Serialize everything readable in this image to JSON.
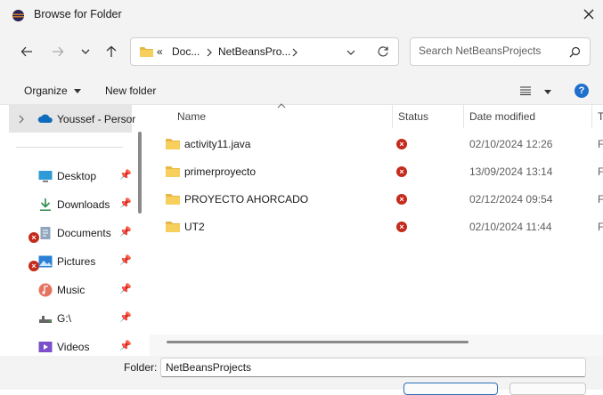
{
  "window": {
    "title": "Browse for Folder"
  },
  "address": {
    "overflow": "«",
    "segments": [
      "Doc...",
      "NetBeansPro..."
    ]
  },
  "search": {
    "placeholder": "Search NetBeansProjects"
  },
  "toolbar": {
    "organize_label": "Organize",
    "new_folder_label": "New folder",
    "help_label": "?"
  },
  "sidebar": {
    "onedrive_label": "Youssef - Persor",
    "items": [
      {
        "label": "Desktop",
        "icon": "desktop-icon",
        "pinned": true,
        "error": false
      },
      {
        "label": "Downloads",
        "icon": "downloads-icon",
        "pinned": true,
        "error": false
      },
      {
        "label": "Documents",
        "icon": "documents-icon",
        "pinned": true,
        "error": true
      },
      {
        "label": "Pictures",
        "icon": "pictures-icon",
        "pinned": true,
        "error": true
      },
      {
        "label": "Music",
        "icon": "music-icon",
        "pinned": true,
        "error": false
      },
      {
        "label": "G:\\",
        "icon": "drive-icon",
        "pinned": true,
        "error": false
      },
      {
        "label": "Videos",
        "icon": "videos-icon",
        "pinned": true,
        "error": false
      }
    ]
  },
  "columns": {
    "name": "Name",
    "status": "Status",
    "date": "Date modified",
    "type": "T"
  },
  "files": [
    {
      "name": "activity11.java",
      "date": "02/10/2024 12:26",
      "type": "F"
    },
    {
      "name": "primerproyecto",
      "date": "13/09/2024 13:14",
      "type": "F"
    },
    {
      "name": "PROYECTO AHORCADO",
      "date": "02/12/2024 09:54",
      "type": "F"
    },
    {
      "name": "UT2",
      "date": "02/10/2024 11:44",
      "type": "F"
    }
  ],
  "footer": {
    "folder_label": "Folder:",
    "folder_value": "NetBeansProjects"
  },
  "colors": {
    "accent": "#2d6fb8",
    "error": "#c42b1c",
    "folder": "#e8b74a",
    "selected_bg": "#e5e5e5"
  }
}
